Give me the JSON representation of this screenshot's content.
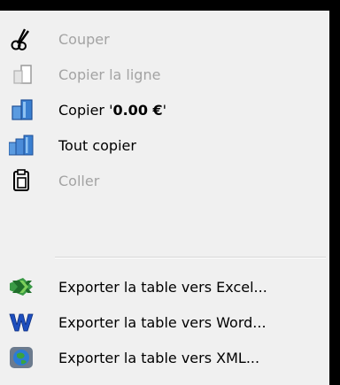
{
  "menu": {
    "items": [
      {
        "label": "Couper",
        "icon": "scissors-icon",
        "enabled": false
      },
      {
        "label": "Copier la ligne",
        "icon": "copy-line-icon",
        "enabled": false
      },
      {
        "label_prefix": "Copier '",
        "label_bold": "0.00 €",
        "label_suffix": "'",
        "icon": "copy-value-icon",
        "enabled": true
      },
      {
        "label": "Tout copier",
        "icon": "copy-all-icon",
        "enabled": true
      },
      {
        "label": "Coller",
        "icon": "paste-icon",
        "enabled": false
      },
      {
        "label": "Exporter la table vers Excel...",
        "icon": "excel-icon",
        "enabled": true
      },
      {
        "label": "Exporter la table vers Word...",
        "icon": "word-icon",
        "enabled": true
      },
      {
        "label": "Exporter la table vers XML...",
        "icon": "xml-globe-icon",
        "enabled": true
      }
    ]
  },
  "colors": {
    "menu_background": "#f0f0f0",
    "disabled_text": "#a3a3a3",
    "enabled_text": "#000000",
    "excel_green": "#2e8b3a",
    "word_blue": "#1e4fbf"
  }
}
